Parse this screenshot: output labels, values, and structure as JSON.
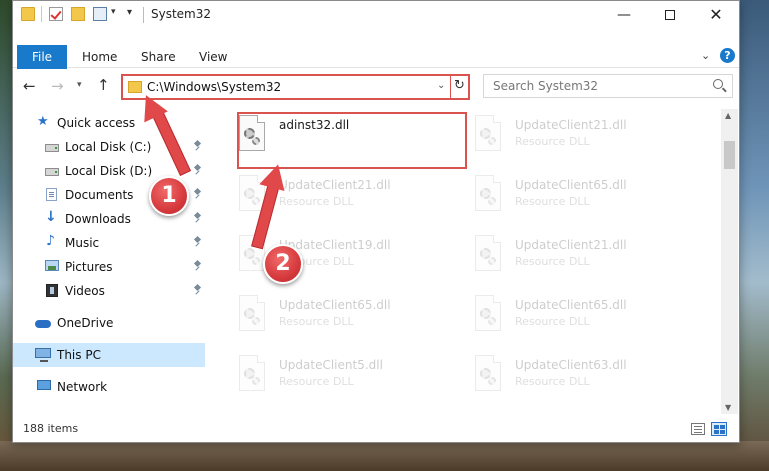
{
  "window": {
    "title": "System32"
  },
  "window_controls": {
    "minimize": "—",
    "close": "✕"
  },
  "ribbon": {
    "tabs": [
      "File",
      "Home",
      "Share",
      "View"
    ],
    "help": "?"
  },
  "nav": {
    "back": "←",
    "forward": "→",
    "up": "↑"
  },
  "address": {
    "path": "C:\\Windows\\System32"
  },
  "search": {
    "placeholder": "Search System32"
  },
  "navpane": {
    "items": [
      {
        "label": "Quick access"
      },
      {
        "label": "Local Disk (C:)"
      },
      {
        "label": "Local Disk (D:)"
      },
      {
        "label": "Documents"
      },
      {
        "label": "Downloads"
      },
      {
        "label": "Music"
      },
      {
        "label": "Pictures"
      },
      {
        "label": "Videos"
      },
      {
        "label": "OneDrive"
      },
      {
        "label": "This PC"
      },
      {
        "label": "Network"
      }
    ]
  },
  "files": [
    {
      "name": "adinst32.dll",
      "type": ""
    },
    {
      "name": "UpdateClient21.dll",
      "type": "Resource DLL"
    },
    {
      "name": "UpdateClient21.dll",
      "type": "Resource DLL"
    },
    {
      "name": "UpdateClient65.dll",
      "type": "Resource DLL"
    },
    {
      "name": "UpdateClient19.dll",
      "type": "Resource DLL"
    },
    {
      "name": "UpdateClient21.dll",
      "type": "Resource DLL"
    },
    {
      "name": "UpdateClient65.dll",
      "type": "Resource DLL"
    },
    {
      "name": "UpdateClient65.dll",
      "type": "Resource DLL"
    },
    {
      "name": "UpdateClient5.dll",
      "type": "Resource DLL"
    },
    {
      "name": "UpdateClient63.dll",
      "type": "Resource DLL"
    }
  ],
  "status": {
    "item_count": "188 items"
  },
  "callouts": [
    {
      "number": "1"
    },
    {
      "number": "2"
    }
  ],
  "colors": {
    "accent": "#1979ca",
    "highlight_red": "#d9534f",
    "selected_bg": "#cce8ff"
  }
}
